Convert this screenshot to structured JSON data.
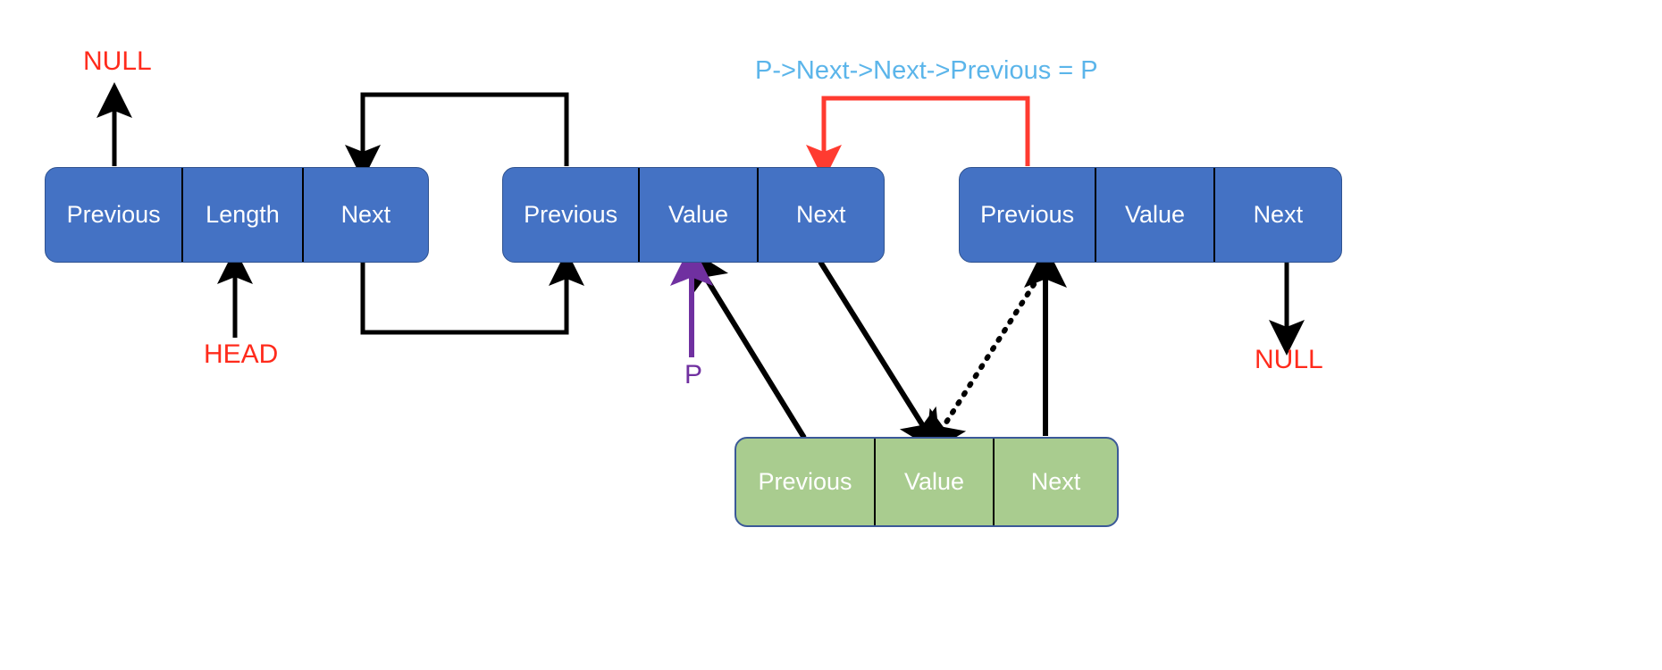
{
  "diagram": {
    "title": "Doubly linked list insertion pointer update",
    "colors": {
      "node_blue": "#4472C4",
      "node_green": "#A9CC8F",
      "null_red": "#FF2B1C",
      "pointer_purple": "#7030A0",
      "expr_cyan": "#5BB5EA",
      "arrow_black": "#000000",
      "arrow_red": "#FF3B30"
    },
    "nodes": [
      {
        "id": "header",
        "kind": "header",
        "color": "blue",
        "cells": [
          {
            "label": "Previous"
          },
          {
            "label": "Length"
          },
          {
            "label": "Next"
          }
        ]
      },
      {
        "id": "node-a",
        "kind": "list-node",
        "color": "blue",
        "cells": [
          {
            "label": "Previous"
          },
          {
            "label": "Value"
          },
          {
            "label": "Next"
          }
        ]
      },
      {
        "id": "node-b",
        "kind": "list-node",
        "color": "blue",
        "cells": [
          {
            "label": "Previous"
          },
          {
            "label": "Value"
          },
          {
            "label": "Next"
          }
        ]
      },
      {
        "id": "node-new",
        "kind": "new-node",
        "color": "green",
        "cells": [
          {
            "label": "Previous"
          },
          {
            "label": "Value"
          },
          {
            "label": "Next"
          }
        ]
      }
    ],
    "labels": {
      "null_top_left": "NULL",
      "head": "HEAD",
      "pointer_p": "P",
      "expression": "P->Next->Next->Previous = P",
      "null_bottom_right": "NULL"
    }
  }
}
